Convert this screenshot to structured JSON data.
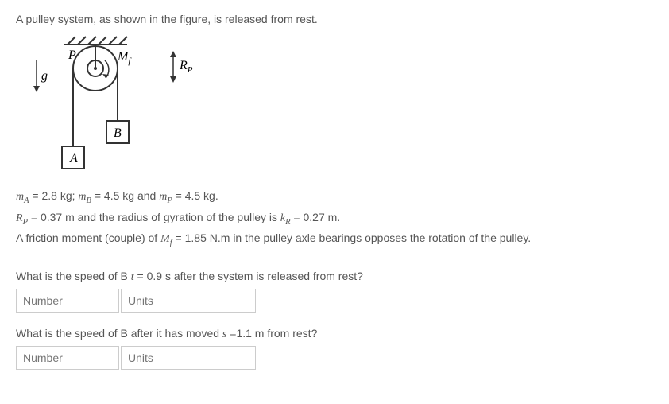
{
  "intro": "A pulley system, as shown in the figure, is released from rest.",
  "params": {
    "mA_label": "m",
    "mA_sub": "A",
    "mA_val": " = 2.8 kg; ",
    "mB_label": "m",
    "mB_sub": "B",
    "mB_val": " = 4.5 kg and ",
    "mP_label": "m",
    "mP_sub": "P",
    "mP_val": " = 4.5 kg.",
    "RP_label": "R",
    "RP_sub": "P",
    "RP_val": " = 0.37 m and the radius of gyration of the pulley is ",
    "kR_label": "k",
    "kR_sub": "R",
    "kR_val": " = 0.27 m.",
    "fric_pre": "A friction moment (couple) of ",
    "Mf_label": "M",
    "Mf_sub": "f",
    "Mf_val": " = 1.85 N.m in the pulley axle bearings opposes the rotation of the pulley."
  },
  "q1": {
    "pre": "What is the speed of B ",
    "tvar": "t",
    "tval": " = 0.9 s after the system is released from rest?",
    "num_ph": "Number",
    "units_ph": "Units"
  },
  "q2": {
    "pre": "What is the speed of B after it has moved ",
    "svar": "s",
    "sval": " =1.1 m from rest?",
    "num_ph": "Number",
    "units_ph": "Units"
  },
  "fig": {
    "P": "P",
    "Mf": "M",
    "Mf_sub": "f",
    "Rp": "R",
    "Rp_sub": "P",
    "g": "g",
    "A": "A",
    "B": "B"
  }
}
